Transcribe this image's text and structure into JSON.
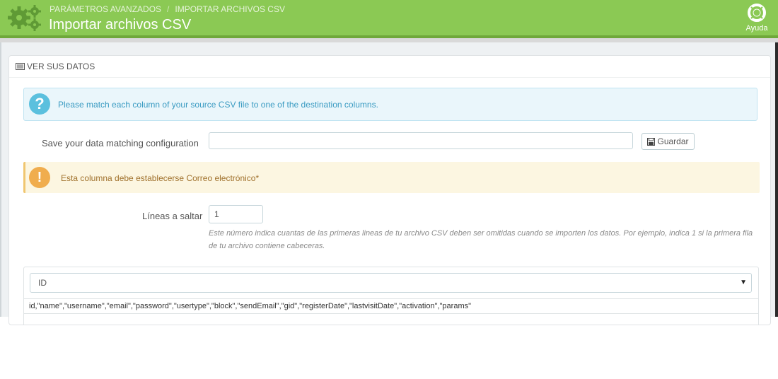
{
  "header": {
    "breadcrumb": [
      "PARÁMETROS AVANZADOS",
      "IMPORTAR ARCHIVOS CSV"
    ],
    "breadcrumb_sep": "/",
    "title": "Importar archivos CSV",
    "help_label": "Ayuda",
    "colors": {
      "bar": "#8bc954",
      "bar_border": "#6fa83a"
    }
  },
  "panel": {
    "heading": "VER SUS DATOS",
    "info_message": "Please match each column of your source CSV file to one of the destination columns.",
    "save_label": "Save your data matching configuration",
    "save_input_value": "",
    "save_button": "Guardar",
    "warning_message": "Esta columna debe establecerse Correo electrónico*",
    "skip_label": "Líneas a saltar",
    "skip_value": "1",
    "skip_help": "Este número indica cuantas de las primeras lineas de tu archivo CSV deben ser omitidas cuando se importen los datos. Por ejemplo, indica 1 si la primera fila de tu archivo contiene cabeceras.",
    "column_select_value": "ID",
    "csv_header_line": "id,\"name\",\"username\",\"email\",\"password\",\"usertype\",\"block\",\"sendEmail\",\"gid\",\"registerDate\",\"lastvisitDate\",\"activation\",\"params\""
  },
  "icons": [
    "gears-icon",
    "lifebuoy-icon",
    "list-icon",
    "question-icon",
    "floppy-disk-icon",
    "exclamation-icon",
    "caret-down-icon"
  ]
}
